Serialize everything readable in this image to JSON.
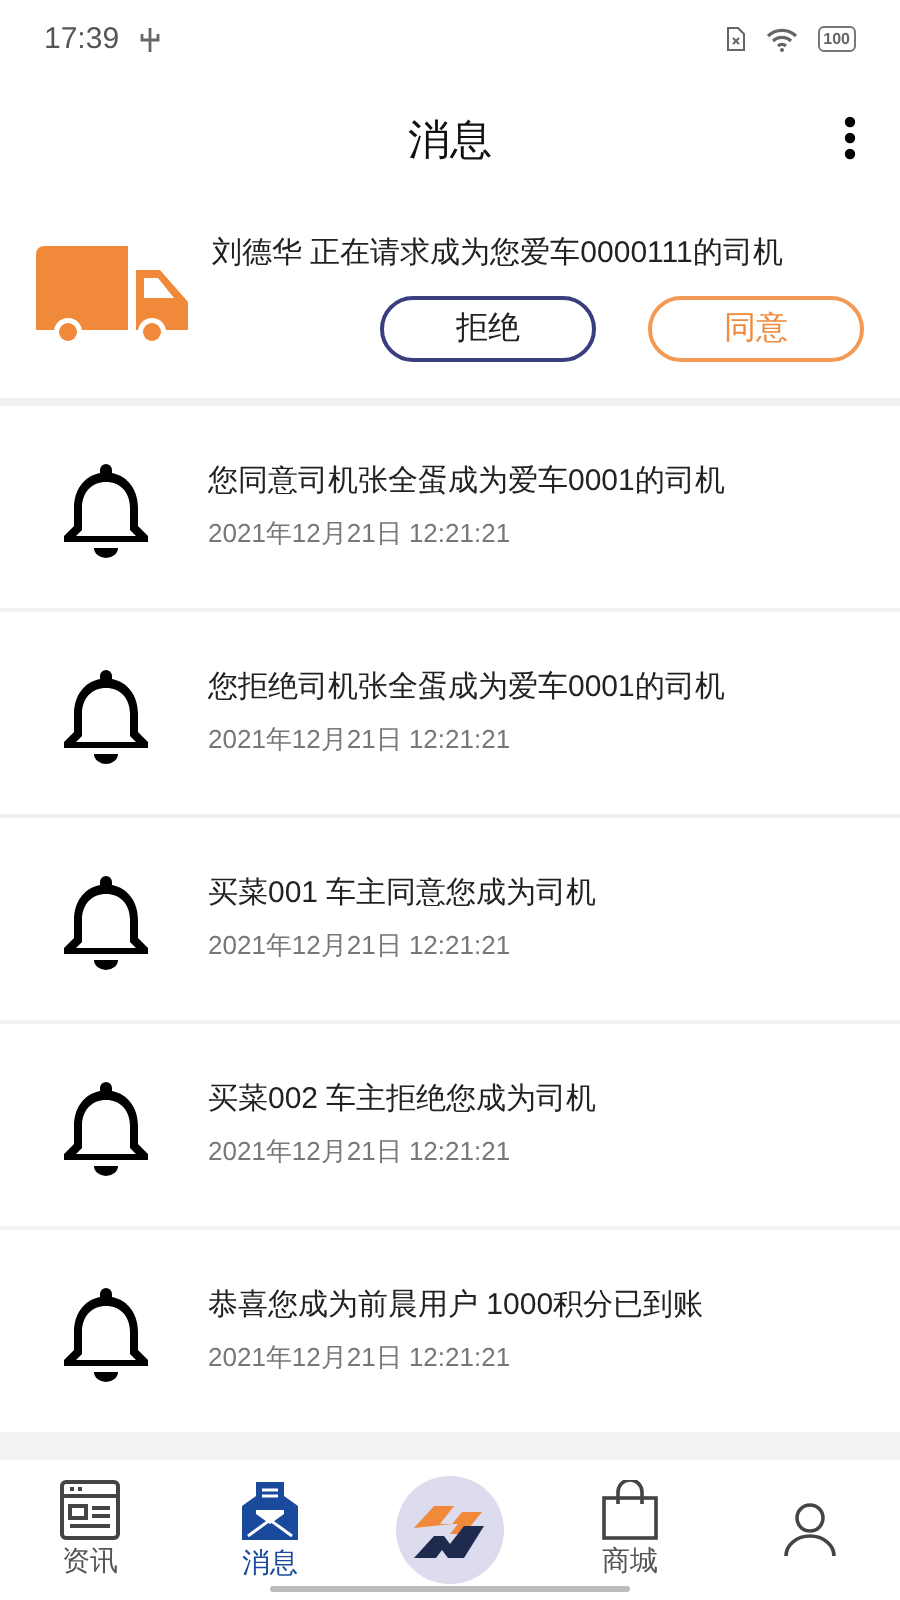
{
  "status_bar": {
    "time": "17:39",
    "battery": "100"
  },
  "header": {
    "title": "消息"
  },
  "request": {
    "message": "刘德华 正在请求成为您爱车0000111的司机",
    "buttons": [
      {
        "label": "拒绝",
        "kind": "reject"
      },
      {
        "label": "同意",
        "kind": "accept"
      }
    ]
  },
  "notifications": [
    {
      "message": "您同意司机张全蛋成为爱车0001的司机",
      "time": "2021年12月21日 12:21:21"
    },
    {
      "message": "您拒绝司机张全蛋成为爱车0001的司机",
      "time": "2021年12月21日 12:21:21"
    },
    {
      "message": "买菜001 车主同意您成为司机",
      "time": "2021年12月21日 12:21:21"
    },
    {
      "message": "买菜002 车主拒绝您成为司机",
      "time": "2021年12月21日 12:21:21"
    },
    {
      "message": "恭喜您成为前晨用户 1000积分已到账",
      "time": "2021年12月21日 12:21:21"
    }
  ],
  "bottom_nav": [
    {
      "label": "资讯",
      "kind": "news",
      "selected": false
    },
    {
      "label": "消息",
      "kind": "mail",
      "selected": true
    },
    {
      "kind": "logo",
      "selected": false
    },
    {
      "label": "商城",
      "kind": "shop",
      "selected": false
    },
    {
      "kind": "profile",
      "selected": false
    }
  ]
}
